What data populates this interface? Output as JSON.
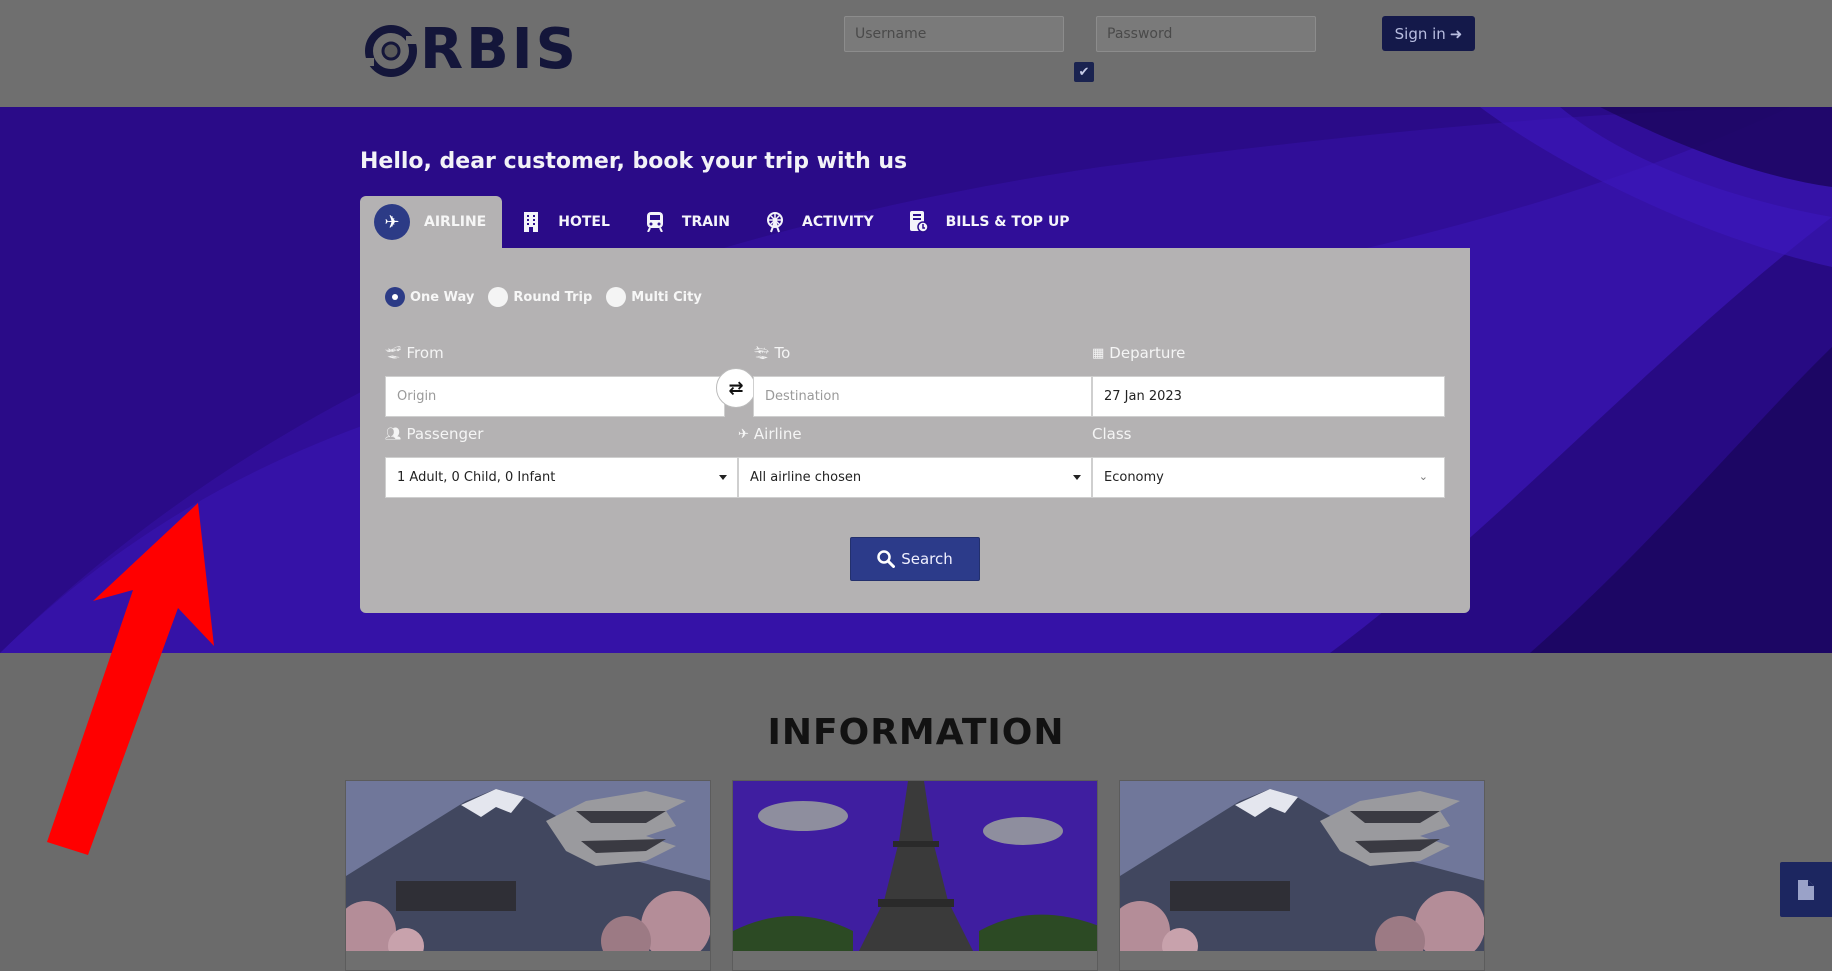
{
  "header": {
    "logo_text": "RBIS",
    "username_placeholder": "Username",
    "password_placeholder": "Password",
    "signin_label": "Sign in",
    "remember_check": "✔"
  },
  "hero": {
    "title": "Hello, dear customer, book your trip with us"
  },
  "tabs": [
    {
      "label": "AIRLINE",
      "icon": "airplane-icon",
      "active": true
    },
    {
      "label": "HOTEL",
      "icon": "building-icon",
      "active": false
    },
    {
      "label": "TRAIN",
      "icon": "train-icon",
      "active": false
    },
    {
      "label": "ACTIVITY",
      "icon": "ferris-wheel-icon",
      "active": false
    },
    {
      "label": "BILLS & TOP UP",
      "icon": "bill-icon",
      "active": false
    }
  ],
  "trip_types": [
    {
      "label": "One Way",
      "selected": true
    },
    {
      "label": "Round Trip",
      "selected": false
    },
    {
      "label": "Multi City",
      "selected": false
    }
  ],
  "form": {
    "from_label": "From",
    "from_placeholder": "Origin",
    "to_label": "To",
    "to_placeholder": "Destination",
    "departure_label": "Departure",
    "departure_value": "27 Jan 2023",
    "passenger_label": "Passenger",
    "passenger_value": "1 Adult, 0 Child, 0 Infant",
    "airline_label": "Airline",
    "airline_value": "All airline chosen",
    "class_label": "Class",
    "class_value": "Economy",
    "search_label": "Search"
  },
  "information": {
    "title": "INFORMATION"
  },
  "colors": {
    "hero_bg": "#2b0d8c",
    "accent": "#2c3b86",
    "panel_bg": "#b4b2b3",
    "annotation_arrow": "#ff0000"
  }
}
